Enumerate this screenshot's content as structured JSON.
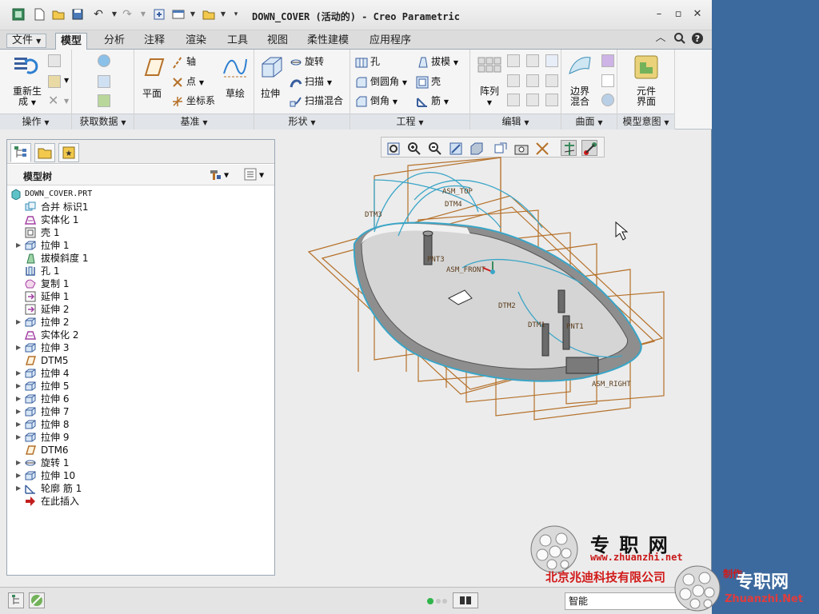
{
  "title_bar": {
    "title": "DOWN_COVER (活动的) - Creo Parametric"
  },
  "menu": {
    "file_label": "文件",
    "tabs": [
      "模型",
      "分析",
      "注释",
      "渲染",
      "工具",
      "视图",
      "柔性建模",
      "应用程序"
    ]
  },
  "ribbon": {
    "operations": {
      "regenerate": "重新生",
      "regenerate_line2": "成",
      "group_label": "操作"
    },
    "get_data": {
      "group_label": "获取数据"
    },
    "datum": {
      "plane": "平面",
      "axis": "轴",
      "point": "点",
      "csys": "坐标系",
      "sketch": "草绘",
      "group_label": "基准"
    },
    "shapes": {
      "extrude": "拉伸",
      "revolve": "旋转",
      "sweep": "扫描",
      "swept_blend": "扫描混合",
      "group_label": "形状"
    },
    "engineering": {
      "hole": "孔",
      "round": "倒圆角",
      "chamfer": "倒角",
      "draft": "拔模",
      "shell": "壳",
      "rib": "筋",
      "group_label": "工程"
    },
    "editing": {
      "pattern": "阵列",
      "group_label": "编辑"
    },
    "surfaces": {
      "boundary_blend": "边界",
      "boundary_blend_line2": "混合",
      "group_label": "曲面"
    },
    "model_intent": {
      "component_interface": "元件",
      "component_interface_line2": "界面",
      "group_label": "模型意图"
    }
  },
  "model_tree": {
    "header": "模型树",
    "items": [
      {
        "label": "DOWN_COVER.PRT",
        "icon": "part-icon",
        "expandable": false,
        "root": true
      },
      {
        "label": "合并 标识1",
        "icon": "merge-icon",
        "expandable": false
      },
      {
        "label": "实体化 1",
        "icon": "solidify-icon",
        "expandable": false
      },
      {
        "label": "壳 1",
        "icon": "shell-icon",
        "expandable": false
      },
      {
        "label": "拉伸 1",
        "icon": "extrude-icon",
        "expandable": true
      },
      {
        "label": "拔模斜度 1",
        "icon": "draft-icon",
        "expandable": false
      },
      {
        "label": "孔 1",
        "icon": "hole-icon",
        "expandable": false
      },
      {
        "label": "复制 1",
        "icon": "copy-icon",
        "expandable": false
      },
      {
        "label": "延伸 1",
        "icon": "extend-icon",
        "expandable": false
      },
      {
        "label": "延伸 2",
        "icon": "extend-icon",
        "expandable": false
      },
      {
        "label": "拉伸 2",
        "icon": "extrude-icon",
        "expandable": true
      },
      {
        "label": "实体化 2",
        "icon": "solidify-icon",
        "expandable": false
      },
      {
        "label": "拉伸 3",
        "icon": "extrude-icon",
        "expandable": true
      },
      {
        "label": "DTM5",
        "icon": "datum-plane-icon",
        "expandable": false
      },
      {
        "label": "拉伸 4",
        "icon": "extrude-icon",
        "expandable": true
      },
      {
        "label": "拉伸 5",
        "icon": "extrude-icon",
        "expandable": true
      },
      {
        "label": "拉伸 6",
        "icon": "extrude-icon",
        "expandable": true
      },
      {
        "label": "拉伸 7",
        "icon": "extrude-icon",
        "expandable": true
      },
      {
        "label": "拉伸 8",
        "icon": "extrude-icon",
        "expandable": true
      },
      {
        "label": "拉伸 9",
        "icon": "extrude-icon",
        "expandable": true
      },
      {
        "label": "DTM6",
        "icon": "datum-plane-icon",
        "expandable": false
      },
      {
        "label": "旋转 1",
        "icon": "revolve-icon",
        "expandable": true
      },
      {
        "label": "拉伸 10",
        "icon": "extrude-icon",
        "expandable": true
      },
      {
        "label": "轮廓 筋 1",
        "icon": "rib-icon",
        "expandable": true
      },
      {
        "label": "在此插入",
        "icon": "insert-arrow-icon",
        "expandable": false
      }
    ]
  },
  "viewport": {
    "datum_labels": [
      "DTM3",
      "ASM_TOP",
      "DTM4",
      "PNT3",
      "ASM_FRONT",
      "DTM2",
      "DTM1",
      "PNT1",
      "ASM_RIGHT"
    ]
  },
  "status_bar": {
    "filter_value": "智能"
  },
  "watermark": {
    "site_cn": "专 职 网",
    "site_url": "www.zhuanzhi.net",
    "company": "北京兆迪科技有限公司",
    "suffix": "制作",
    "corner_cn": "专职网",
    "corner_en": "Zhuanzhi.Net"
  },
  "colors": {
    "datum_plane": "#b5712a",
    "curve": "#3aa5c7",
    "desktop": "#3d6a9e",
    "watermark_red": "#d11a1a"
  }
}
